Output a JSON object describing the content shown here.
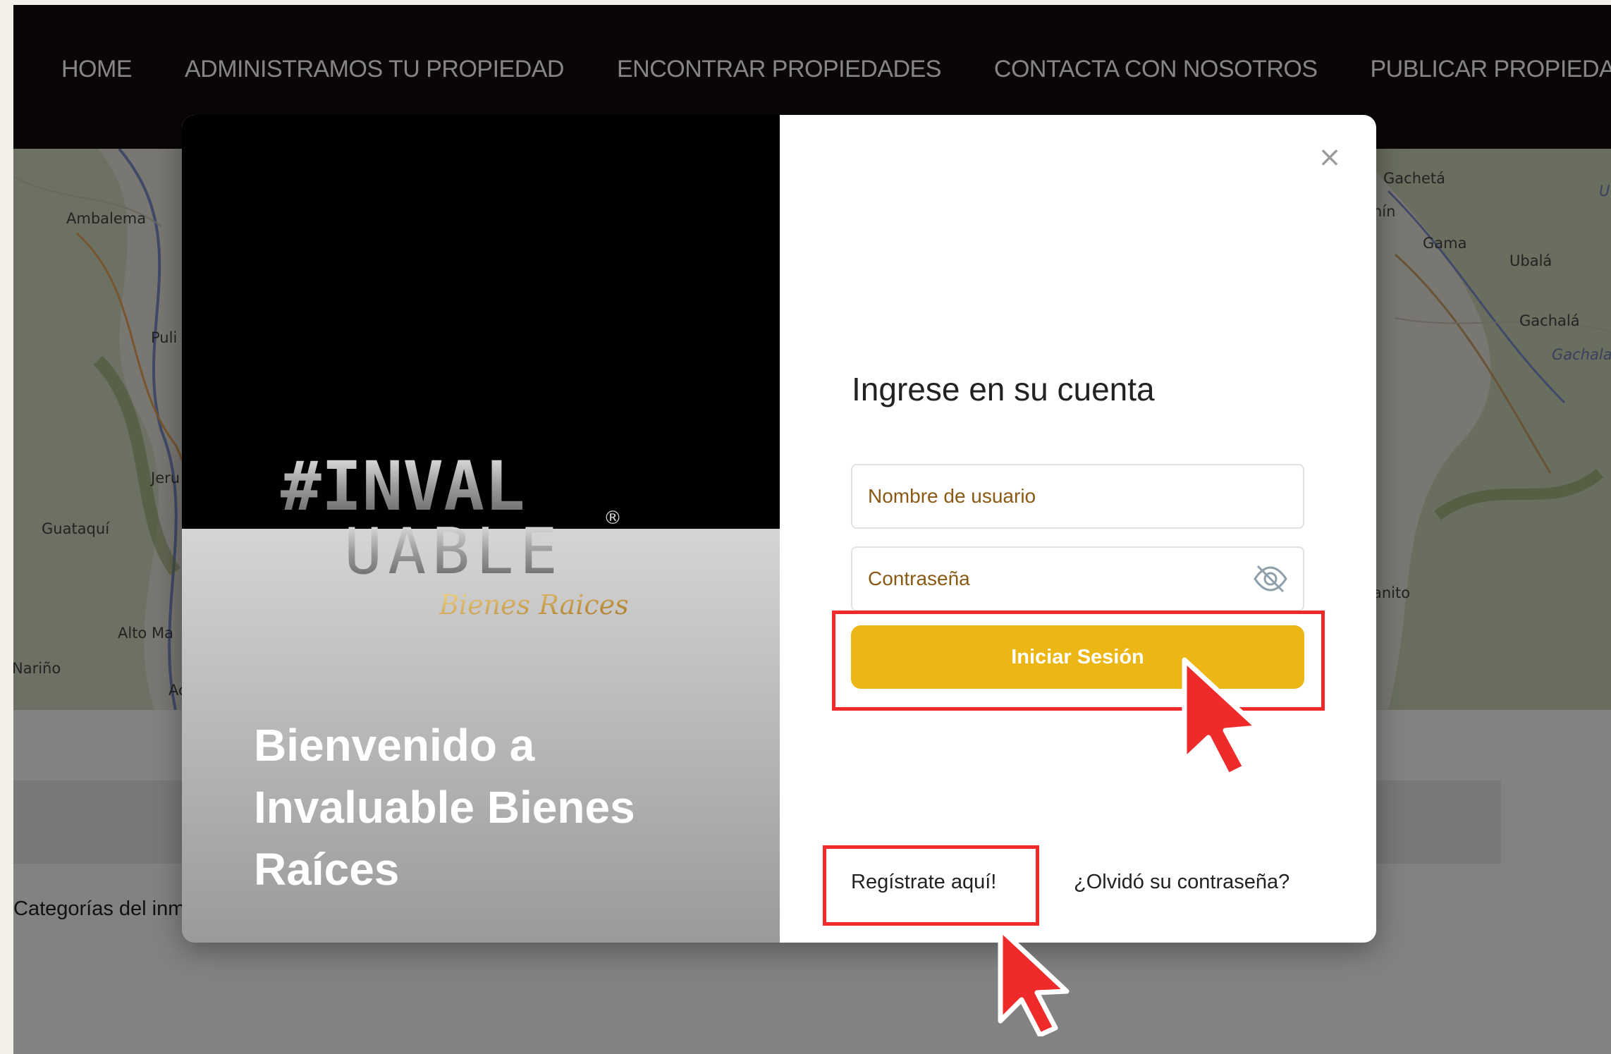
{
  "nav": {
    "items": [
      {
        "label": "HOME"
      },
      {
        "label": "ADMINISTRAMOS TU PROPIEDAD"
      },
      {
        "label": "ENCONTRAR PROPIEDADES"
      },
      {
        "label": "CONTACTA CON NOSOTROS"
      },
      {
        "label": "PUBLICAR PROPIEDAD"
      }
    ]
  },
  "map": {
    "towns": [
      "Ambalema",
      "Puli",
      "Jeru",
      "Guataquí",
      "Alto Ma",
      "Nariño",
      "Ac",
      "Gachetá",
      "nín",
      "Gama",
      "Ubalá",
      "Gachalá",
      "Gachala",
      "anito",
      "U"
    ]
  },
  "page": {
    "categories_label": "Categorías del inm"
  },
  "modal": {
    "logo": {
      "line1": "#INVAL",
      "line2": "UABLE",
      "tagline": "Bienes Raices",
      "registered": "®"
    },
    "welcome": "Bienvenido a Invaluable Bienes Raíces",
    "close_symbol": "×",
    "title": "Ingrese en su cuenta",
    "username_placeholder": "Nombre de usuario",
    "password_placeholder": "Contraseña",
    "login_button": "Iniciar Sesión",
    "register_link": "Regístrate aquí!",
    "forgot_link": "¿Olvidó su contraseña?"
  },
  "colors": {
    "nav_bg": "#120c0a",
    "accent_button": "#ecb614",
    "highlight": "#ee2a2a",
    "input_text": "#8a5a14"
  }
}
